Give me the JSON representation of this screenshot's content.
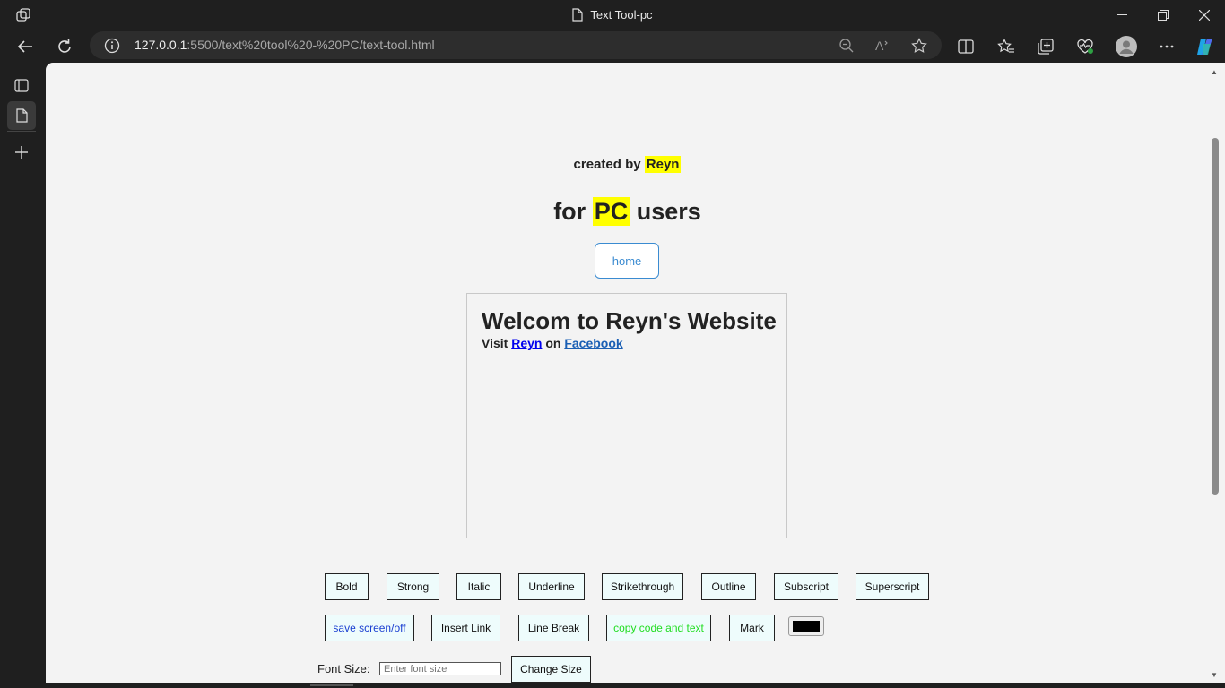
{
  "window": {
    "title": "Text Tool-pc"
  },
  "address_bar": {
    "url_host": "127.0.0.1",
    "url_rest": ":5500/text%20tool%20-%20PC/text-tool.html"
  },
  "page": {
    "created_prefix": "created by",
    "created_name": "Reyn",
    "heading_pre": "for",
    "heading_highlight": "PC",
    "heading_post": "users",
    "home_label": "home"
  },
  "editor": {
    "heading": "Welcom to Reyn's Website",
    "visit": "Visit",
    "link1": "Reyn",
    "on": "on",
    "link2": "Facebook"
  },
  "format_buttons": [
    "Bold",
    "Strong",
    "Italic",
    "Underline",
    "Strikethrough",
    "Outline",
    "Subscript",
    "Superscript"
  ],
  "action_buttons": {
    "save": "save screen/off",
    "insert_link": "Insert Link",
    "line_break": "Line Break",
    "copy": "copy code and text",
    "mark": "Mark"
  },
  "colors": {
    "save_text": "#1a3fd1",
    "copy_text": "#22dd22",
    "picker": "#000000",
    "highlight": "#ffff00"
  },
  "font_size": {
    "label": "Font Size:",
    "placeholder": "Enter font size",
    "button": "Change Size"
  }
}
